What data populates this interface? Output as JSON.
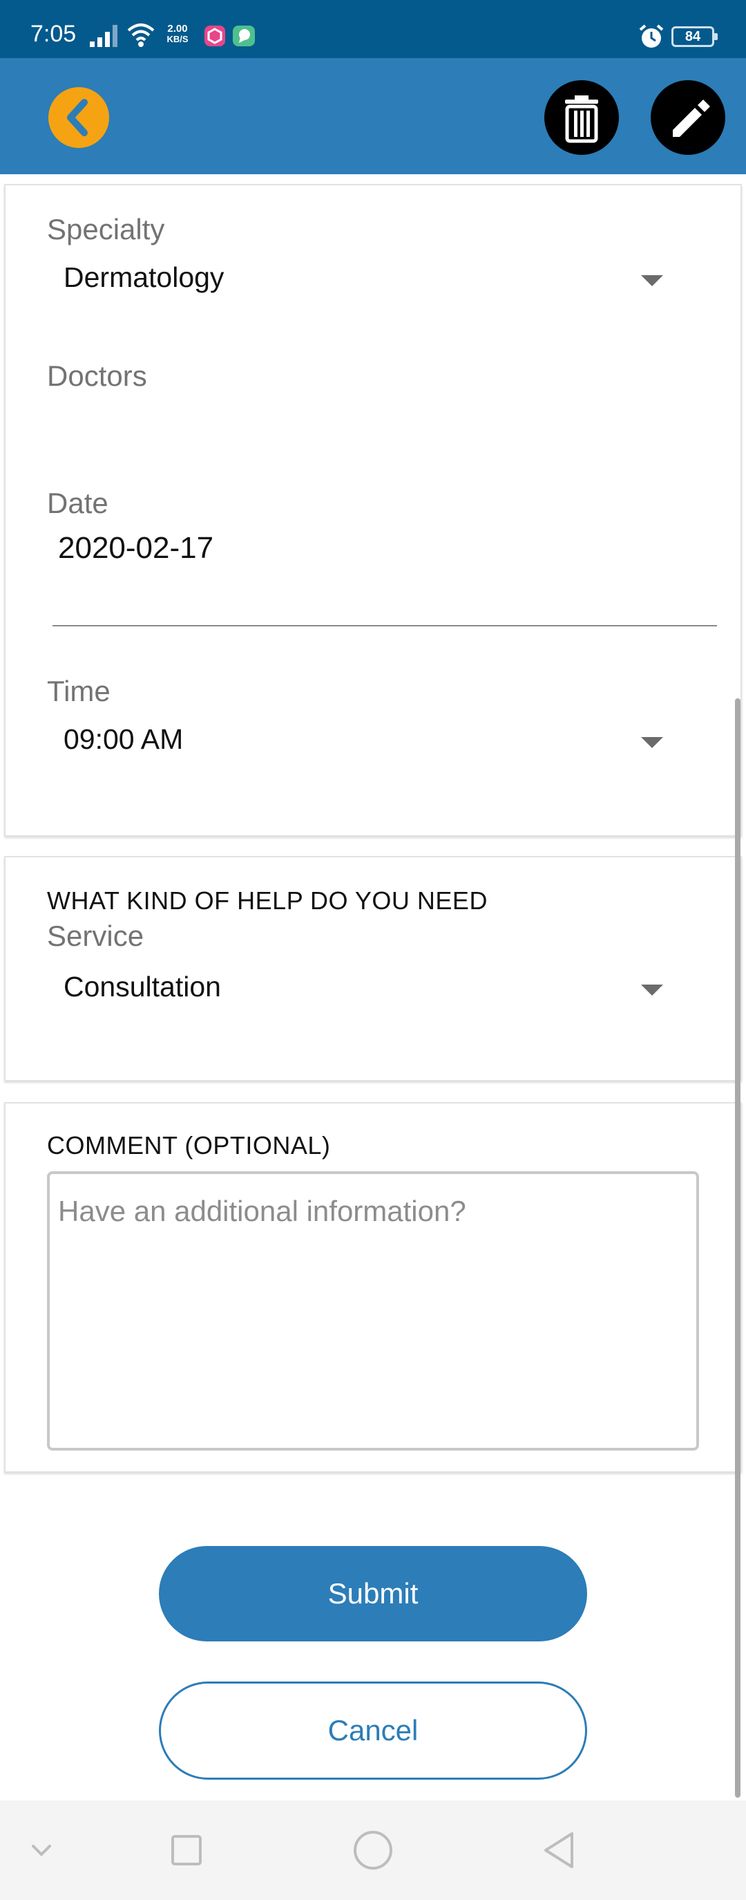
{
  "status_bar": {
    "time": "7:05",
    "net_speed_value": "2.00",
    "net_speed_unit": "KB/S",
    "battery": "84",
    "icons": [
      "signal-icon",
      "wifi-icon",
      "app-notification-icon",
      "chat-notification-icon",
      "alarm-icon",
      "battery-icon"
    ]
  },
  "app_bar": {
    "color": "#2c7db8",
    "back_button_color": "#f5a312",
    "icons": [
      "chevron-left-icon",
      "trash-icon",
      "pencil-icon"
    ]
  },
  "appointment": {
    "specialty_label": "Specialty",
    "specialty_value": "Dermatology",
    "doctors_label": "Doctors",
    "date_label": "Date",
    "date_value": "2020-02-17",
    "time_label": "Time",
    "time_value": "09:00 AM"
  },
  "help": {
    "title": "WHAT KIND OF HELP DO YOU NEED",
    "service_label": "Service",
    "service_value": "Consultation"
  },
  "comment": {
    "title": "COMMENT (OPTIONAL)",
    "placeholder": "Have an additional information?"
  },
  "actions": {
    "submit_label": "Submit",
    "cancel_label": "Cancel"
  },
  "nav_bar": {
    "icons": [
      "nav-down-icon",
      "recents-square-icon",
      "home-circle-icon",
      "back-triangle-icon"
    ]
  }
}
